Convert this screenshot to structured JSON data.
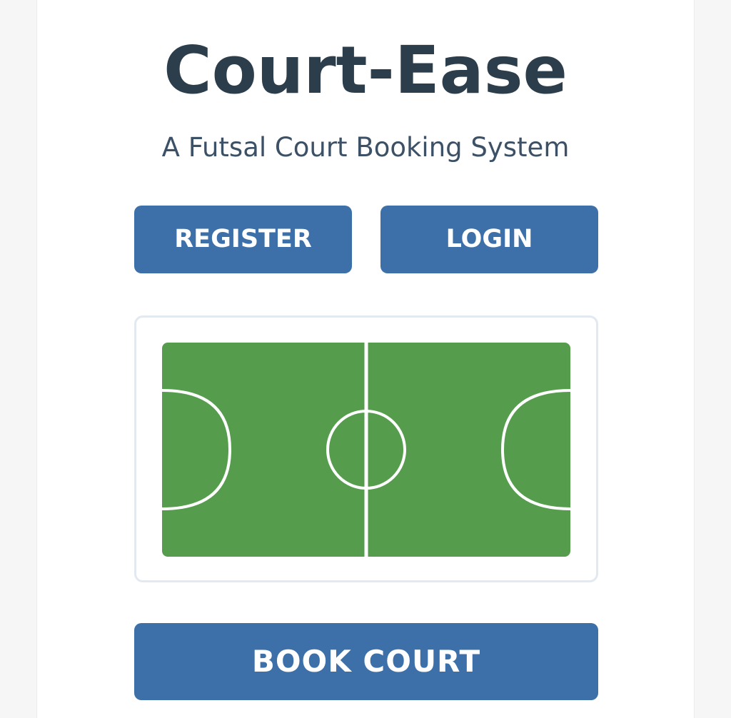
{
  "app": {
    "title": "Court-Ease",
    "subtitle": "A Futsal Court Booking System"
  },
  "actions": {
    "register_label": "REGISTER",
    "login_label": "LOGIN",
    "book_label": "BOOK COURT"
  },
  "colors": {
    "primary": "#3d70a8",
    "title": "#2c3e4b",
    "subtitle": "#3c5066",
    "court_green": "#559d4d",
    "court_lines": "#ffffff",
    "frame_border": "#e3e9f0"
  },
  "icons": {
    "court": "futsal-court-illustration"
  }
}
